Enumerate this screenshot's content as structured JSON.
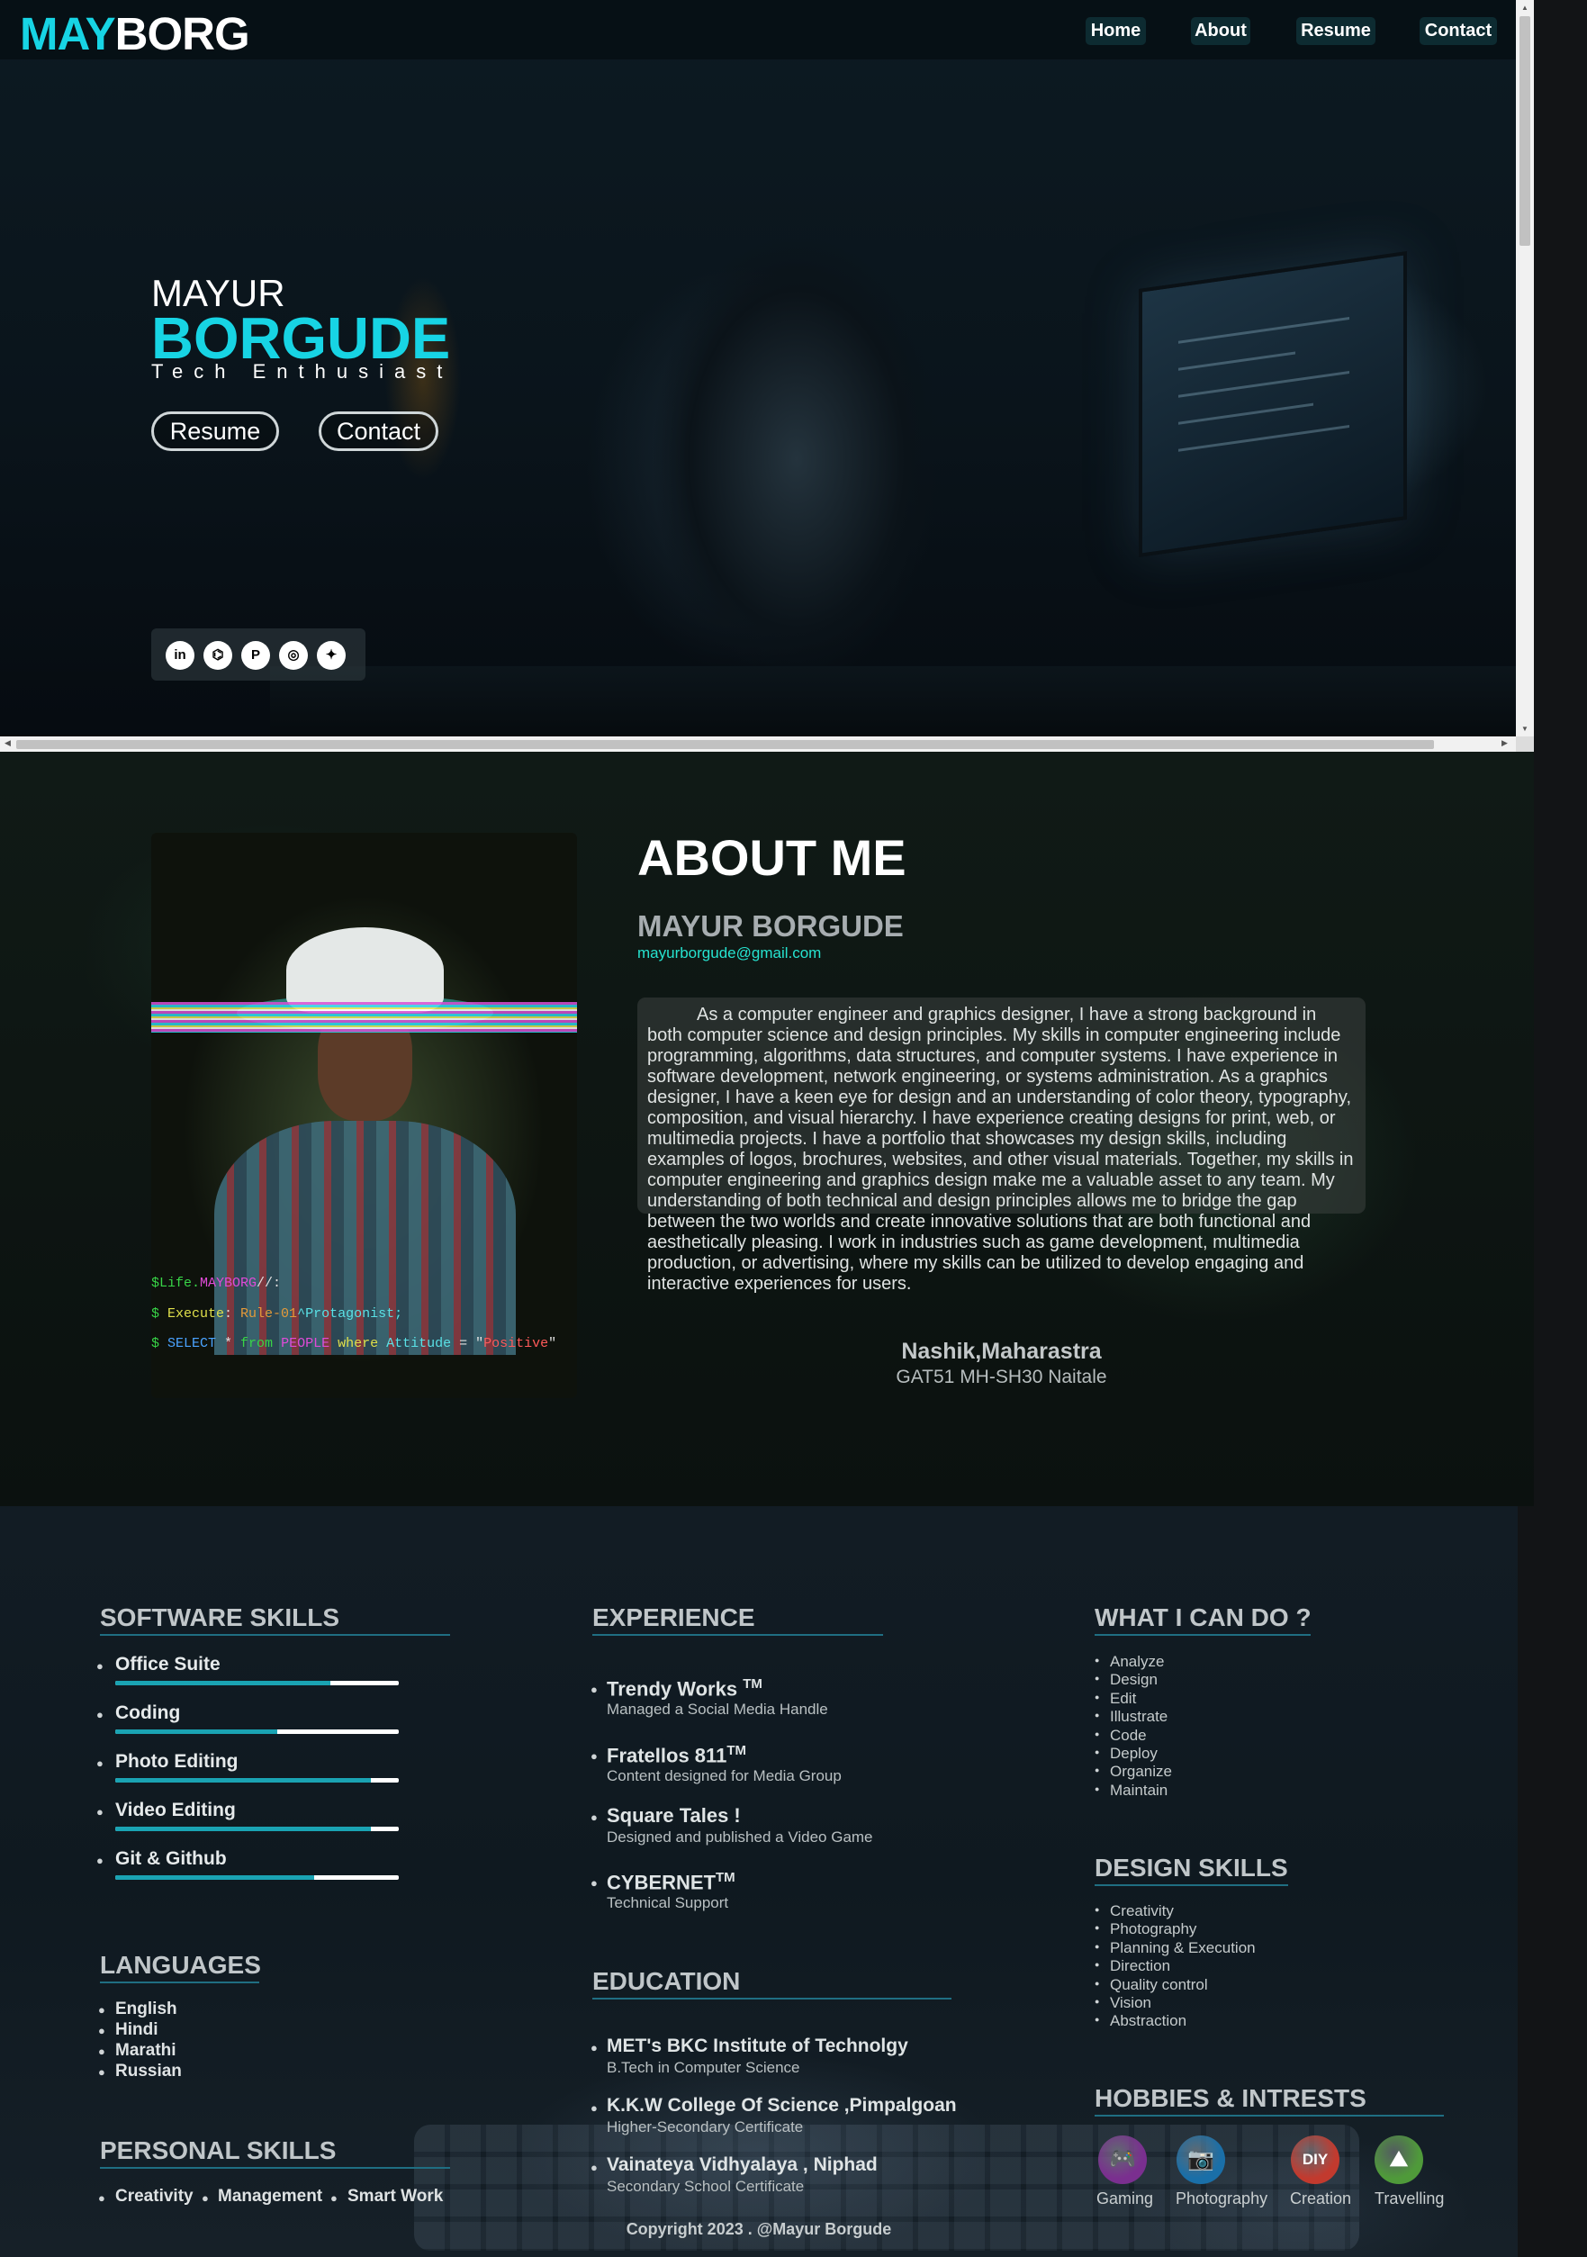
{
  "header": {
    "logo_accent": "MAY",
    "logo_rest": "BORG",
    "nav": [
      "Home",
      "About",
      "Resume",
      "Contact"
    ]
  },
  "hero": {
    "first_name": "MAYUR",
    "last_name": "BORGUDE",
    "tagline": "Tech Enthusiast",
    "buttons": [
      "Resume",
      "Contact"
    ],
    "social": [
      {
        "icon": "linkedin-icon",
        "glyph": "in"
      },
      {
        "icon": "github-icon",
        "glyph": "⌬"
      },
      {
        "icon": "pinterest-icon",
        "glyph": "P"
      },
      {
        "icon": "instagram-icon",
        "glyph": "◎"
      },
      {
        "icon": "twitter-icon",
        "glyph": "✦"
      }
    ]
  },
  "about": {
    "title": "ABOUT ME",
    "name": "MAYUR BORGUDE",
    "email": "mayurborgude@gmail.com",
    "bio": "As a computer engineer and graphics designer, I have a strong background in both computer science and design principles. My skills in computer engineering include programming, algorithms, data structures, and computer systems. I have experience in software development, network engineering, or systems administration. As a graphics designer, I have a keen eye for design and an understanding of color theory, typography, composition, and visual hierarchy. I have experience creating designs for print, web, or multimedia projects. I have a portfolio that showcases my design skills, including examples of logos, brochures, websites, and other visual materials. Together, my skills in computer engineering and graphics design make me a valuable asset to any team. My understanding of both technical and design principles allows me to bridge the gap between the two worlds and create innovative solutions that are both functional and aesthetically pleasing. I work in industries such as game development, multimedia production, or advertising, where my skills can be utilized to develop engaging and interactive experiences for users.",
    "location": "Nashik,Maharastra",
    "address": "GAT51   MH-SH30   Naitale",
    "photo_code": {
      "line1_a": "$Life.",
      "line1_b": "MAYBORG",
      "line1_c": "//:",
      "line2_a": "$ ",
      "line2_b": "Execute",
      "line2_c": ": ",
      "line2_d": "Rule-01",
      "line2_e": "^Protagonist;",
      "line3_a": "$ ",
      "line3_b": "SELECT",
      "line3_c": " * ",
      "line3_d": "from",
      "line3_e": " PEOPLE ",
      "line3_f": "where",
      "line3_g": " Attitude",
      "line3_h": " = \"",
      "line3_i": "Positive",
      "line3_j": "\""
    }
  },
  "software_skills": {
    "heading": "SOFTWARE SKILLS",
    "items": [
      {
        "label": "Office Suite",
        "level": 0.76
      },
      {
        "label": "Coding",
        "level": 0.57
      },
      {
        "label": "Photo Editing",
        "level": 0.9
      },
      {
        "label": "Video Editing",
        "level": 0.9
      },
      {
        "label": "Git & Github",
        "level": 0.7
      }
    ]
  },
  "languages": {
    "heading": "LANGUAGES",
    "items": [
      "English",
      "Hindi",
      "Marathi",
      "Russian"
    ]
  },
  "personal_skills": {
    "heading": "PERSONAL SKILLS",
    "items": [
      "Creativity",
      "Management",
      "Smart Work"
    ]
  },
  "experience": {
    "heading": "EXPERIENCE",
    "items": [
      {
        "title": "Trendy Works",
        "mark": "TM",
        "desc": "Managed a Social Media Handle"
      },
      {
        "title": "Fratellos 811",
        "mark": "TM",
        "desc": "Content designed for Media Group"
      },
      {
        "title": "Square Tales !",
        "mark": "",
        "desc": "Designed and published a Video Game"
      },
      {
        "title": "CYBERNET",
        "mark": "TM",
        "desc": "Technical Support"
      }
    ]
  },
  "education": {
    "heading": "EDUCATION",
    "items": [
      {
        "title": "MET's BKC Institute of Technolgy",
        "desc": "B.Tech in Computer Science"
      },
      {
        "title": "K.K.W College Of Science ,Pimpalgoan",
        "desc": "Higher-Secondary Certificate"
      },
      {
        "title": "Vainateya Vidhyalaya , Niphad",
        "desc": "Secondary School Certificate"
      }
    ]
  },
  "what_i_can_do": {
    "heading": "WHAT I CAN DO ?",
    "items": [
      "Analyze",
      "Design",
      "Edit",
      "Illustrate",
      "Code",
      "Deploy",
      "Organize",
      "Maintain"
    ]
  },
  "design_skills": {
    "heading": "DESIGN SKILLS",
    "items": [
      "Creativity",
      "Photography",
      "Planning & Execution",
      "Direction",
      "Quality control",
      "Vision",
      "Abstraction"
    ]
  },
  "hobbies": {
    "heading": "HOBBIES & INTRESTS",
    "items": [
      {
        "label": "Gaming",
        "icon": "gamepad-icon",
        "glyph": "🎮",
        "color": "#7a2f8f"
      },
      {
        "label": "Photography",
        "icon": "camera-icon",
        "glyph": "📷",
        "color": "#1a6fa8"
      },
      {
        "label": "Creation",
        "icon": "diy-icon",
        "glyph": "DIY",
        "color": "#c23a2e"
      },
      {
        "label": "Travelling",
        "icon": "mountain-icon",
        "glyph": "⛰",
        "color": "#4f9a3a"
      }
    ]
  },
  "footer": {
    "copyright": "Copyright 2023 . @Mayur Borgude"
  },
  "colors": {
    "accent": "#17d4e4",
    "bar_fill": "#1aa3b3",
    "email": "#26e3cf"
  }
}
